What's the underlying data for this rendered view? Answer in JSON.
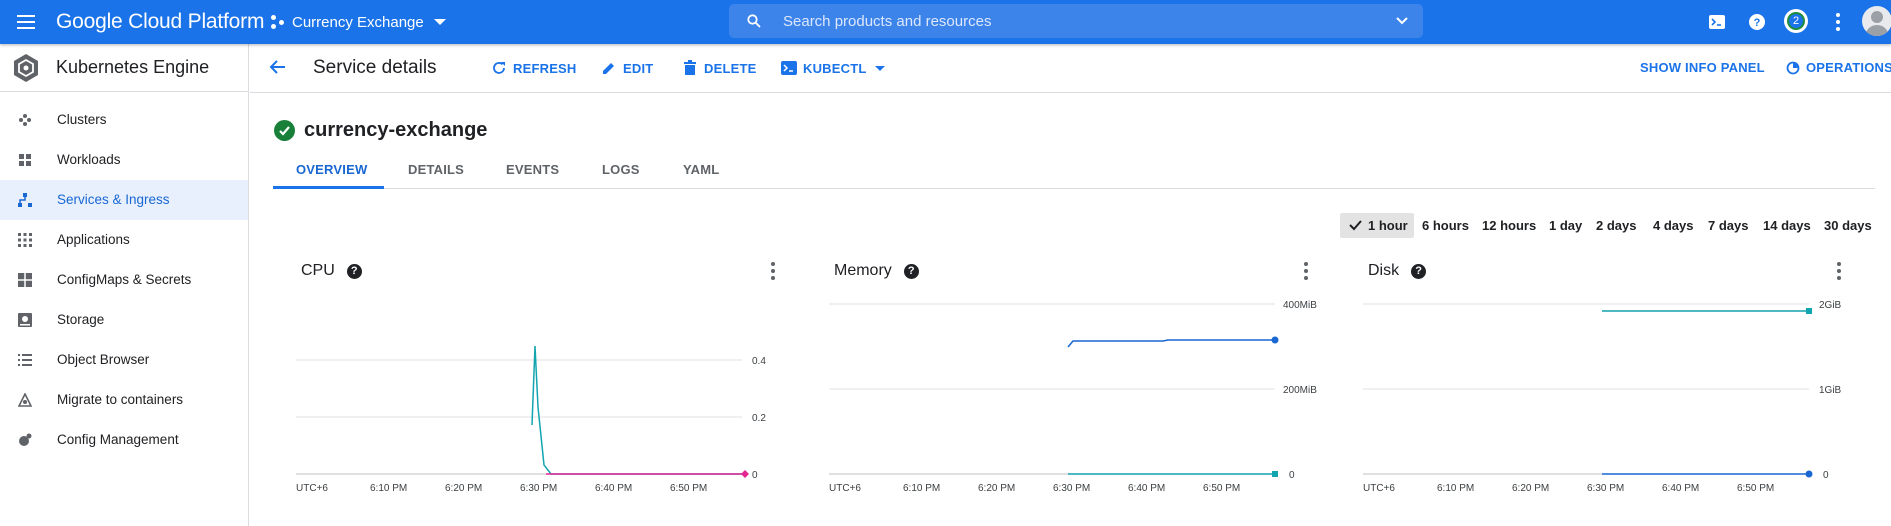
{
  "topbar": {
    "brand": "Google Cloud Platform",
    "project": "Currency Exchange",
    "search_placeholder": "Search products and resources",
    "notification_count": "2"
  },
  "sidebar": {
    "title": "Kubernetes Engine",
    "items": [
      {
        "label": "Clusters",
        "icon": "clusters-icon"
      },
      {
        "label": "Workloads",
        "icon": "workloads-icon"
      },
      {
        "label": "Services & Ingress",
        "icon": "services-icon",
        "active": true
      },
      {
        "label": "Applications",
        "icon": "applications-icon"
      },
      {
        "label": "ConfigMaps & Secrets",
        "icon": "configmaps-icon"
      },
      {
        "label": "Storage",
        "icon": "storage-icon"
      },
      {
        "label": "Object Browser",
        "icon": "list-icon"
      },
      {
        "label": "Migrate to containers",
        "icon": "migrate-icon"
      },
      {
        "label": "Config Management",
        "icon": "config-icon"
      }
    ]
  },
  "header": {
    "title": "Service details",
    "refresh": "REFRESH",
    "edit": "EDIT",
    "delete": "DELETE",
    "kubectl": "KUBECTL",
    "show_info_panel": "SHOW INFO PANEL",
    "operations": "OPERATIONS"
  },
  "service": {
    "name": "currency-exchange",
    "status": "ok"
  },
  "tabs": [
    "OVERVIEW",
    "DETAILS",
    "EVENTS",
    "LOGS",
    "YAML"
  ],
  "time_ranges": {
    "selected": "1 hour",
    "options": [
      "1 hour",
      "6 hours",
      "12 hours",
      "1 day",
      "2 days",
      "4 days",
      "7 days",
      "14 days",
      "30 days"
    ]
  },
  "colors": {
    "accent": "#1a73e8",
    "success": "#188038",
    "cpu_line": "#12a4af",
    "limit_line": "#e52592",
    "mem_line": "#1967d2"
  },
  "charts": {
    "x_tick_labels": [
      "UTC+6",
      "6:10 PM",
      "6:20 PM",
      "6:30 PM",
      "6:40 PM",
      "6:50 PM"
    ],
    "cpu": {
      "title": "CPU",
      "y_ticks": [
        "0.4",
        "0.2",
        "0"
      ]
    },
    "memory": {
      "title": "Memory",
      "y_ticks": [
        "400MiB",
        "200MiB",
        "0"
      ]
    },
    "disk": {
      "title": "Disk",
      "y_ticks": [
        "2GiB",
        "1GiB",
        "0"
      ]
    }
  }
}
